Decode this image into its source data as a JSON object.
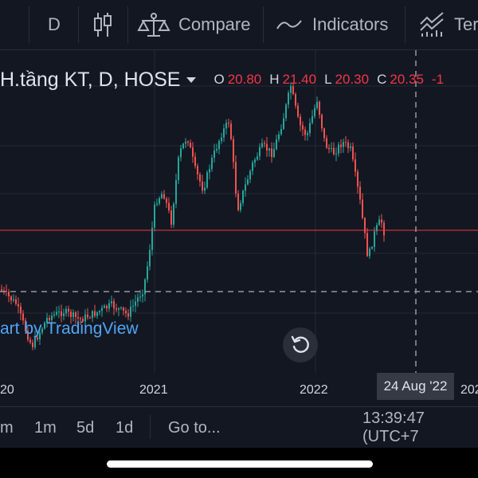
{
  "toolbar": {
    "interval": "D",
    "compare_label": "Compare",
    "indicators_label": "Indicators",
    "templates_label": "Ter"
  },
  "legend": {
    "symbol": "H.tầng KT, D, HOSE",
    "o_label": "O",
    "o_value": "20.80",
    "h_label": "H",
    "h_value": "21.40",
    "l_label": "L",
    "l_value": "20.30",
    "c_label": "C",
    "c_value": "20.35",
    "change": "-1"
  },
  "watermark": "art by TradingView",
  "xaxis": {
    "labels": [
      "20",
      "2021",
      "2022",
      "202"
    ],
    "crosshair_label": "24 Aug '22"
  },
  "bottombar": {
    "ranges": [
      "m",
      "1m",
      "5d",
      "1d"
    ],
    "goto_label": "Go to...",
    "clock": "13:39:47 (UTC+7"
  },
  "colors": {
    "background": "#131722",
    "up": "#26a69a",
    "down": "#ef5350",
    "price_line": "#f23645",
    "watermark": "#4fa6f5"
  },
  "chart_data": {
    "type": "candlestick",
    "symbol": "H.tầng KT",
    "interval": "D",
    "exchange": "HOSE",
    "x_ticks": [
      "20",
      "2021",
      "2022",
      "202"
    ],
    "last_bar": {
      "open": 20.8,
      "high": 21.4,
      "low": 20.3,
      "close": 20.35
    },
    "crosshair_date": "24 Aug '22",
    "grid": true
  }
}
